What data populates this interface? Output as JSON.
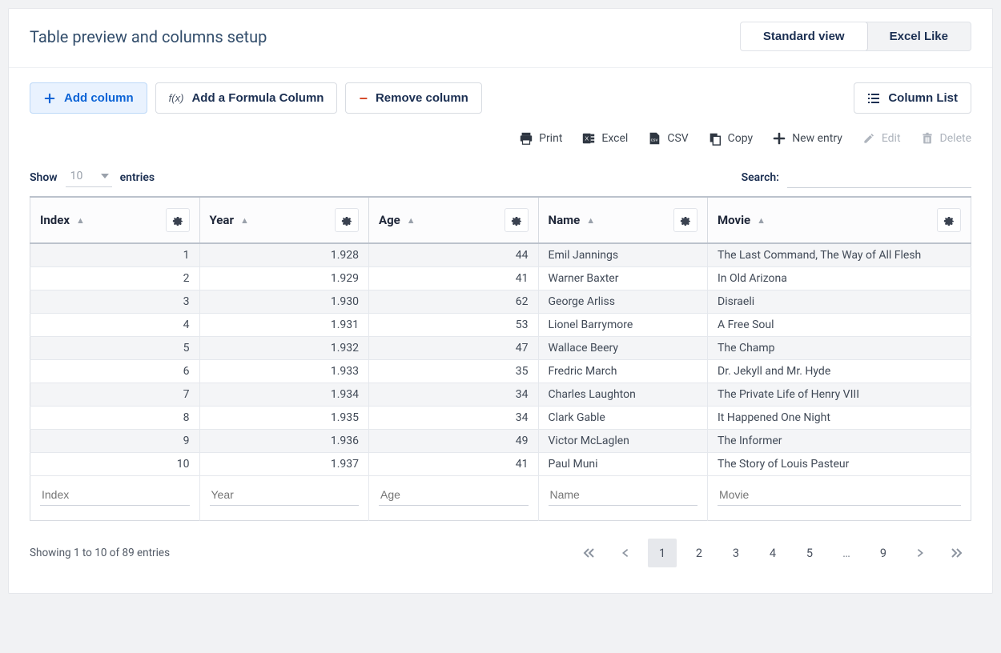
{
  "header": {
    "title": "Table preview and columns setup",
    "view_standard": "Standard view",
    "view_excel": "Excel Like"
  },
  "toolbar": {
    "add_column": "Add column",
    "add_formula": "Add a Formula Column",
    "remove_column": "Remove column",
    "column_list": "Column List"
  },
  "actions": {
    "print": "Print",
    "excel": "Excel",
    "csv": "CSV",
    "copy": "Copy",
    "new_entry": "New entry",
    "edit": "Edit",
    "delete": "Delete"
  },
  "controls": {
    "show_label": "Show",
    "entries_value": "10",
    "entries_label": "entries",
    "search_label": "Search:"
  },
  "columns": [
    {
      "key": "index",
      "label": "Index",
      "align": "num"
    },
    {
      "key": "year",
      "label": "Year",
      "align": "num"
    },
    {
      "key": "age",
      "label": "Age",
      "align": "num"
    },
    {
      "key": "name",
      "label": "Name",
      "align": "txt"
    },
    {
      "key": "movie",
      "label": "Movie",
      "align": "txt"
    }
  ],
  "rows": [
    {
      "index": "1",
      "year": "1.928",
      "age": "44",
      "name": "Emil Jannings",
      "movie": "The Last Command, The Way of All Flesh"
    },
    {
      "index": "2",
      "year": "1.929",
      "age": "41",
      "name": "Warner Baxter",
      "movie": "In Old Arizona"
    },
    {
      "index": "3",
      "year": "1.930",
      "age": "62",
      "name": "George Arliss",
      "movie": "Disraeli"
    },
    {
      "index": "4",
      "year": "1.931",
      "age": "53",
      "name": "Lionel Barrymore",
      "movie": "A Free Soul"
    },
    {
      "index": "5",
      "year": "1.932",
      "age": "47",
      "name": "Wallace Beery",
      "movie": "The Champ"
    },
    {
      "index": "6",
      "year": "1.933",
      "age": "35",
      "name": "Fredric March",
      "movie": "Dr. Jekyll and Mr. Hyde"
    },
    {
      "index": "7",
      "year": "1.934",
      "age": "34",
      "name": "Charles Laughton",
      "movie": "The Private Life of Henry VIII"
    },
    {
      "index": "8",
      "year": "1.935",
      "age": "34",
      "name": "Clark Gable",
      "movie": "It Happened One Night"
    },
    {
      "index": "9",
      "year": "1.936",
      "age": "49",
      "name": "Victor McLaglen",
      "movie": "The Informer"
    },
    {
      "index": "10",
      "year": "1.937",
      "age": "41",
      "name": "Paul Muni",
      "movie": "The Story of Louis Pasteur"
    }
  ],
  "filters": {
    "index": "Index",
    "year": "Year",
    "age": "Age",
    "name": "Name",
    "movie": "Movie"
  },
  "footer": {
    "info": "Showing 1 to 10 of 89 entries"
  },
  "pager": {
    "pages": [
      "1",
      "2",
      "3",
      "4",
      "5",
      "…",
      "9"
    ],
    "current": "1"
  }
}
